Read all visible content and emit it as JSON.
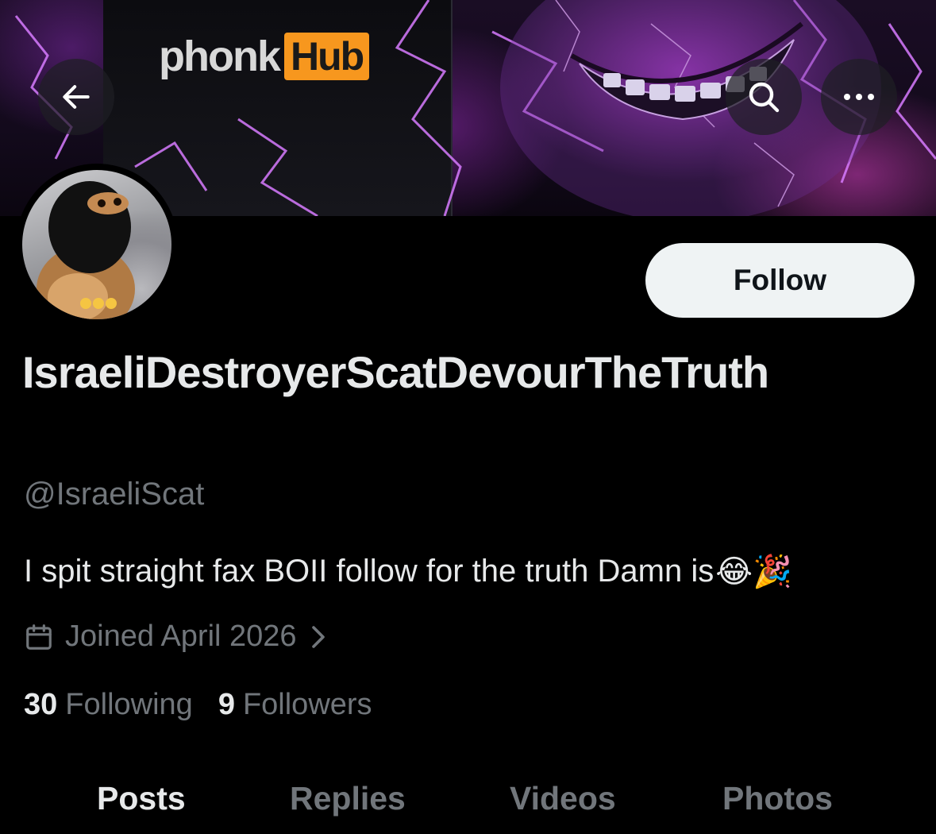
{
  "banner": {
    "brand_left": "phonk",
    "brand_right": "Hub"
  },
  "profile": {
    "display_name": "IsraeliDestroyerScatDevourTheTruth",
    "handle": "@IsraeliScat",
    "bio": "I spit straight fax BOII follow for the truth Damn is",
    "bio_emoji": "😂🎉",
    "joined": "Joined April 2026",
    "following_count": "30",
    "following_label": "Following",
    "followers_count": "9",
    "followers_label": "Followers"
  },
  "actions": {
    "follow_label": "Follow"
  },
  "tabs": [
    {
      "label": "Posts"
    },
    {
      "label": "Replies"
    },
    {
      "label": "Videos"
    },
    {
      "label": "Photos"
    }
  ],
  "colors": {
    "background": "#000000",
    "primary_text": "#e7e9ea",
    "secondary_text": "#71767b",
    "follow_button_bg": "#eff3f4",
    "brand_accent": "#f7971e"
  },
  "icons": {
    "back": "arrow-left-icon",
    "search": "search-icon",
    "more": "more-icon",
    "calendar": "calendar-icon",
    "chevron": "chevron-right-icon"
  }
}
